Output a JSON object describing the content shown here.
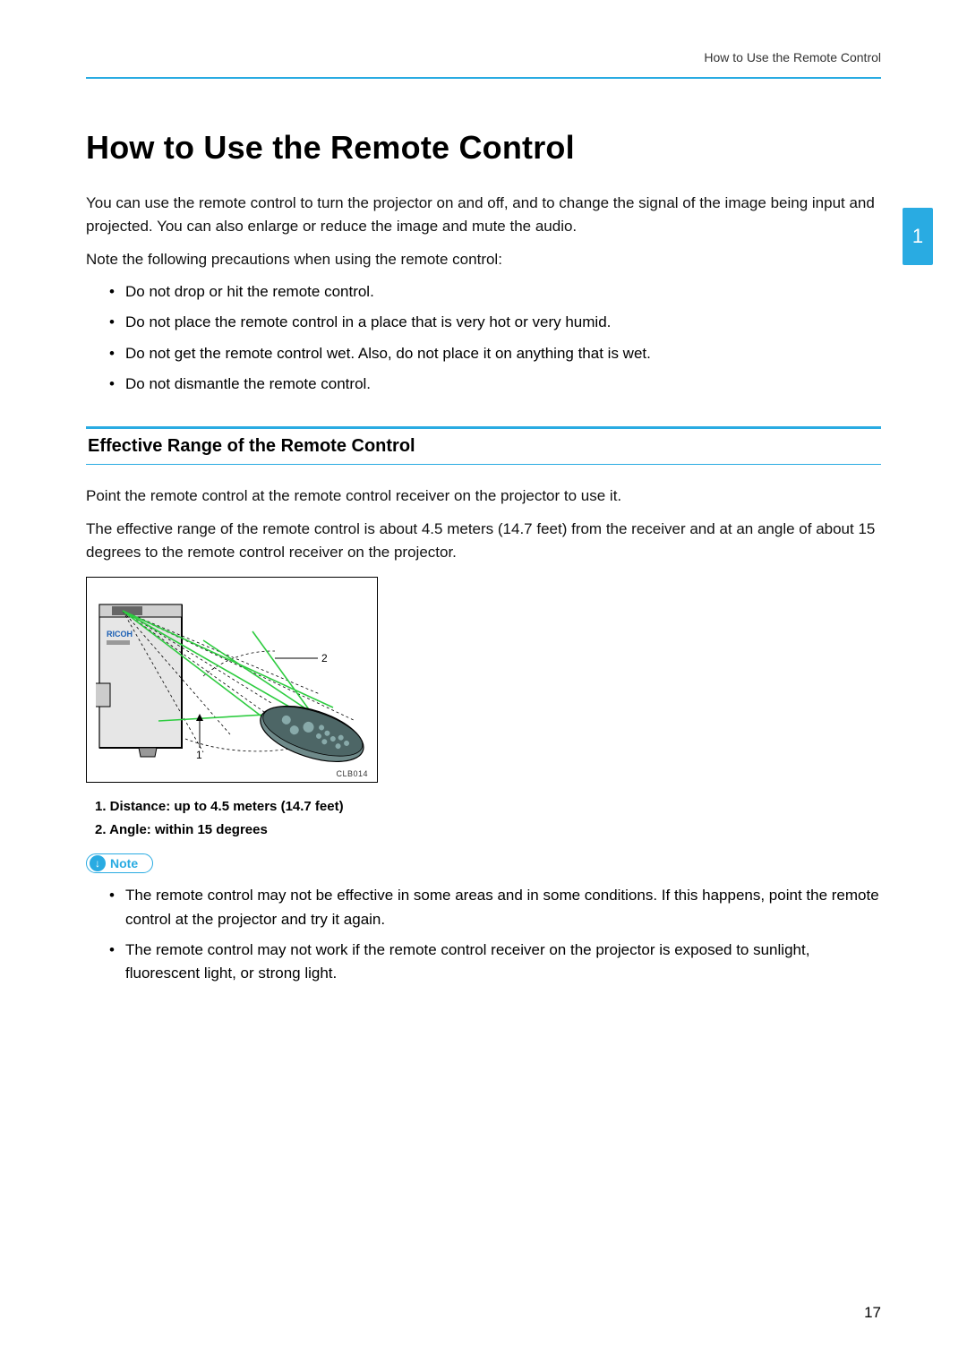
{
  "header": {
    "running_head": "How to Use the Remote Control",
    "chapter_tab": "1"
  },
  "title": "How to Use the Remote Control",
  "intro": {
    "p1": "You can use the remote control to turn the projector on and off, and to change the signal of the image being input and projected. You can also enlarge or reduce the image and mute the audio.",
    "p2": "Note the following precautions when using the remote control:",
    "bullets": [
      "Do not drop or hit the remote control.",
      "Do not place the remote control in a place that is very hot or very humid.",
      "Do not get the remote control wet. Also, do not place it on anything that is wet.",
      "Do not dismantle the remote control."
    ]
  },
  "section": {
    "heading": "Effective Range of the Remote Control",
    "p1": "Point the remote control at the remote control receiver on the projector to use it.",
    "p2": "The effective range of the remote control is about 4.5 meters (14.7 feet) from the receiver and at an angle of about 15 degrees to the remote control receiver on the projector."
  },
  "figure": {
    "brand_label": "RICOH",
    "callout_1": "1",
    "callout_2": "2",
    "code": "CLB014",
    "legend": [
      "1.  Distance: up to 4.5 meters (14.7 feet)",
      "2.  Angle: within 15 degrees"
    ]
  },
  "note": {
    "label": "Note",
    "bullets": [
      "The remote control may not be effective in some areas and in some conditions. If this happens, point the remote control at the projector and try it again.",
      "The remote control may not work if the remote control receiver on the projector is exposed to sunlight, fluorescent light, or strong light."
    ]
  },
  "page_number": "17"
}
